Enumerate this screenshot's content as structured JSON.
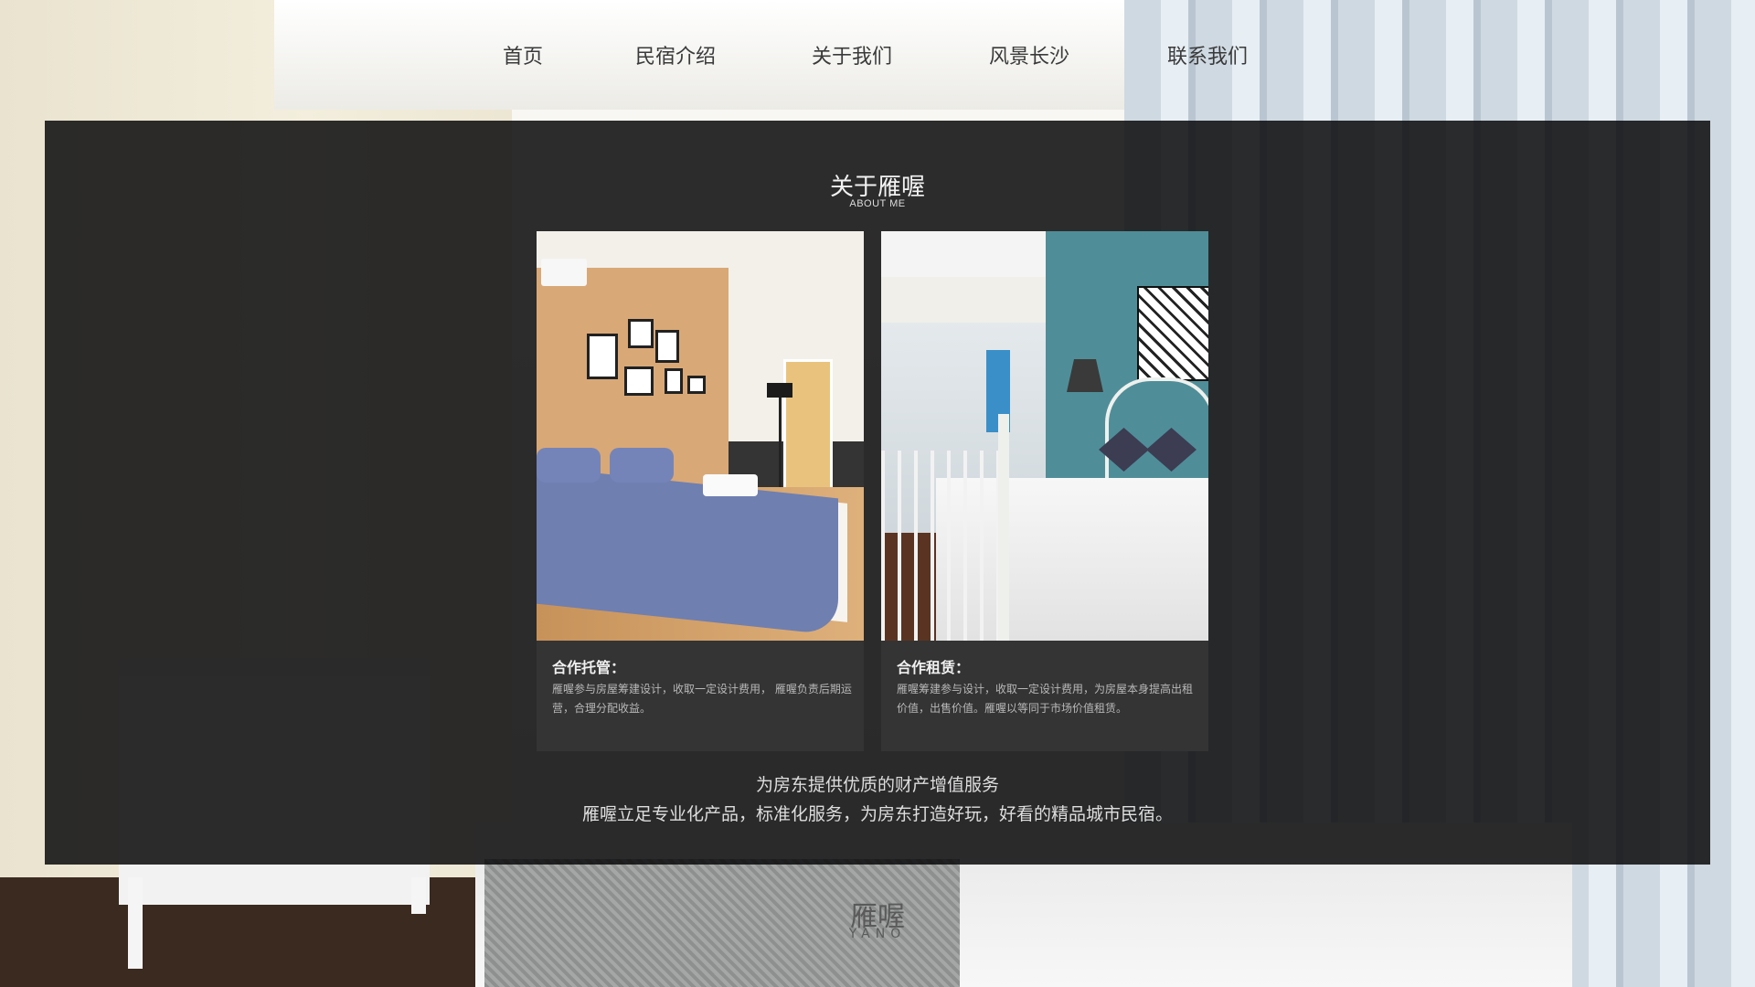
{
  "nav": {
    "items": [
      "首页",
      "民宿介绍",
      "关于我们",
      "风景长沙",
      "联系我们"
    ]
  },
  "section": {
    "title": "关于雁喔",
    "subtitle": "ABOUT ME"
  },
  "cards": [
    {
      "title": "合作托管：",
      "text": "雁喔参与房屋筹建设计，收取一定设计费用， 雁喔负责后期运营，合理分配收益。"
    },
    {
      "title": "合作租赁：",
      "text": "雁喔筹建参与设计，收取一定设计费用，为房屋本身提高出租价值，出售价值。雁喔以等同于市场价值租赁。"
    }
  ],
  "slogan": {
    "line1": "为房东提供优质的财产增值服务",
    "line2": "雁喔立足专业化产品，标准化服务，为房东打造好玩，好看的精品城市民宿。"
  },
  "logo": {
    "name": "雁喔",
    "latin": "YANŌ"
  },
  "colors": {
    "panel": "#0a0a0c",
    "card": "#343434"
  }
}
